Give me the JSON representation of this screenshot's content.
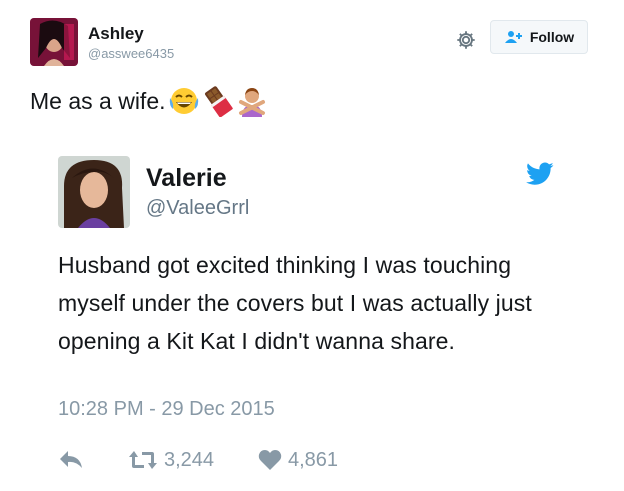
{
  "outer_tweet": {
    "author_name": "Ashley",
    "author_handle": "@asswee6435",
    "follow_label": "Follow",
    "text": "Me as a wife.",
    "emojis": [
      "face-with-tears-of-joy-emoji",
      "chocolate-bar-emoji",
      "person-gesturing-no-emoji"
    ]
  },
  "quoted_tweet": {
    "author_name": "Valerie",
    "author_handle": "@ValeeGrrl",
    "text": "Husband got excited thinking I was touching myself under the covers but I was actually just opening a Kit Kat I didn't wanna share.",
    "timestamp": "10:28 PM - 29 Dec 2015",
    "retweets": "3,244",
    "likes": "4,861"
  },
  "icons": {
    "settings": "gear-icon",
    "follow": "add-user-icon",
    "twitter_logo": "twitter-bird-icon",
    "reply": "reply-icon",
    "retweet": "retweet-icon",
    "like": "heart-icon"
  },
  "colors": {
    "twitter_blue": "#1da1f2",
    "text_primary": "#14171a",
    "text_secondary": "#8899a6",
    "border": "#e1e8ed"
  }
}
